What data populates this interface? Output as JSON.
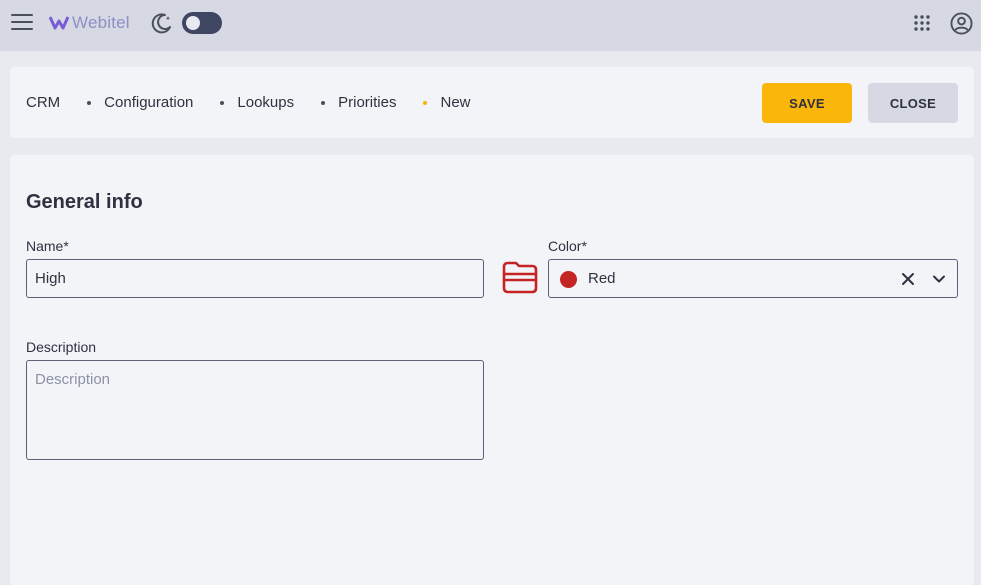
{
  "topbar": {
    "logo_text": "Webitel",
    "theme_toggle_on": false
  },
  "breadcrumb": {
    "items": [
      "CRM",
      "Configuration",
      "Lookups",
      "Priorities",
      "New"
    ]
  },
  "actions": {
    "save_label": "SAVE",
    "close_label": "CLOSE"
  },
  "form": {
    "section_title": "General info",
    "name_label": "Name*",
    "name_value": "High",
    "color_label": "Color*",
    "color_value": "Red",
    "color_hex": "#c42424",
    "description_label": "Description",
    "description_value": "",
    "description_placeholder": "Description"
  },
  "colors": {
    "accent": "#fbb709",
    "topbar_bg": "#d6d9e3",
    "card_bg": "#f3f4f8",
    "icon_red": "#c42424",
    "logo_purple": "#7b5cd6"
  },
  "icons": [
    "menu-icon",
    "webitel-logo-icon",
    "moon-icon",
    "apps-grid-icon",
    "account-icon",
    "folder-icon",
    "clear-icon",
    "chevron-down-icon"
  ]
}
